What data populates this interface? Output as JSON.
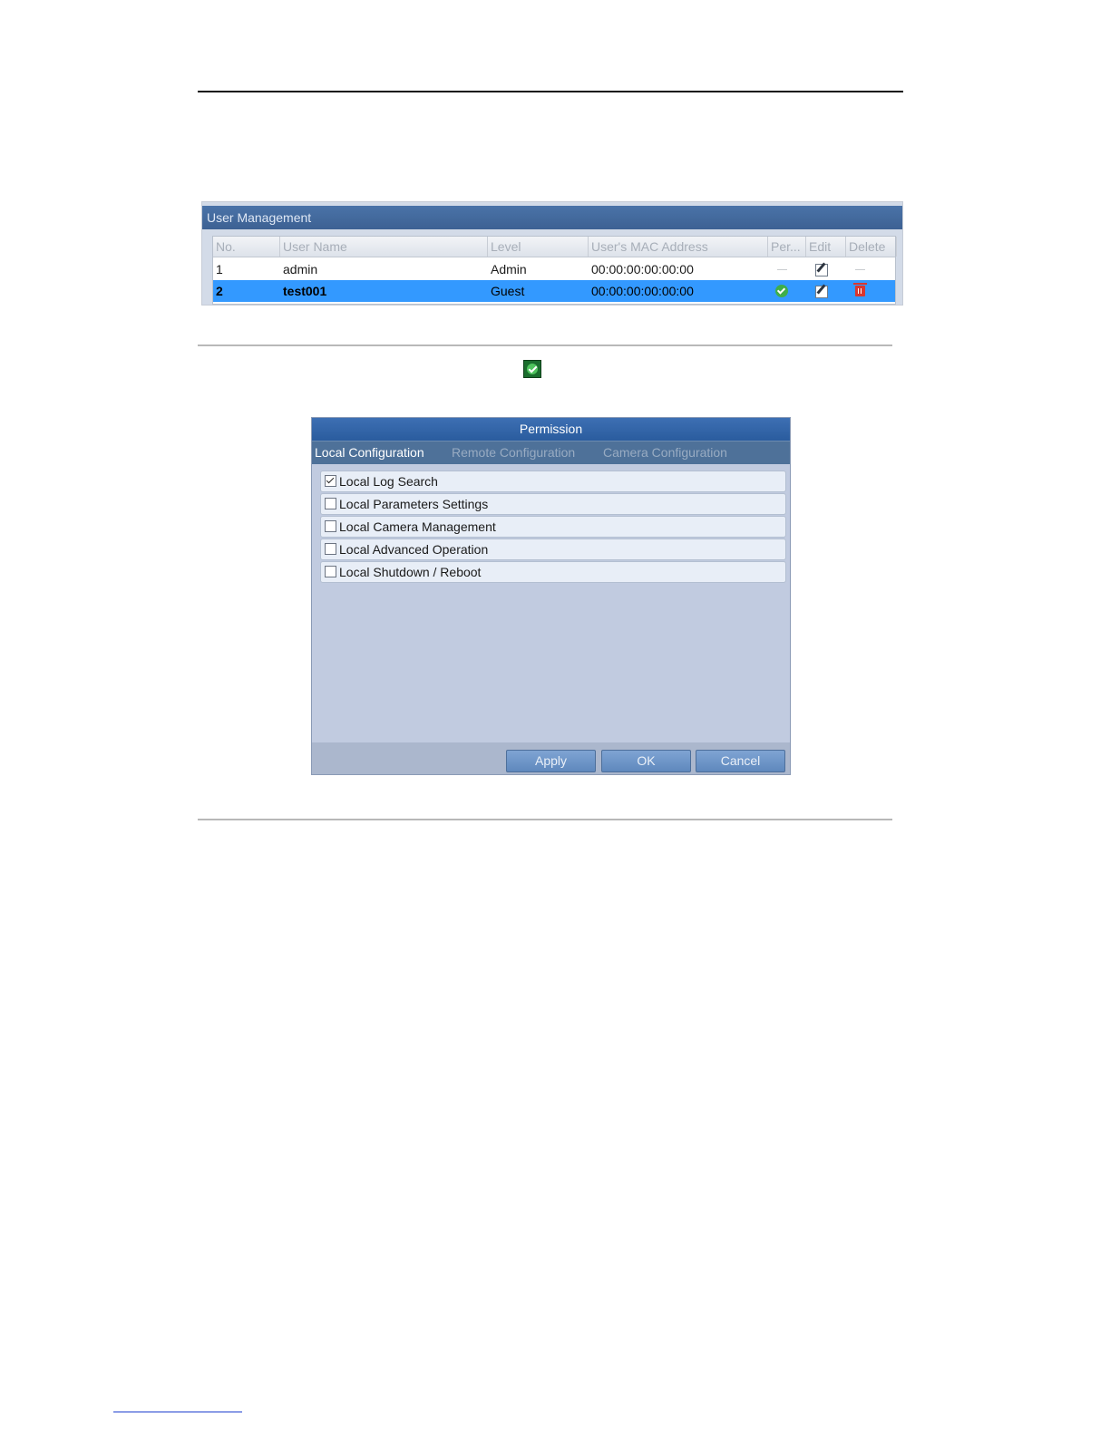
{
  "user_management": {
    "title": "User Management",
    "columns": [
      "No.",
      "User Name",
      "Level",
      "User's MAC Address",
      "Per...",
      "Edit",
      "Delete"
    ],
    "rows": [
      {
        "no": "1",
        "user_name": "admin",
        "level": "Admin",
        "mac": "00:00:00:00:00:00",
        "per": "dash-icon",
        "edit": "edit-icon",
        "delete": "dash-icon",
        "selected": false
      },
      {
        "no": "2",
        "user_name": "test001",
        "level": "Guest",
        "mac": "00:00:00:00:00:00",
        "per": "check-icon",
        "edit": "edit-icon",
        "delete": "trash-icon",
        "selected": true
      }
    ],
    "selected_row_color": "#3399ff"
  },
  "inline_icon": "green-check-icon",
  "permission": {
    "title": "Permission",
    "tabs": [
      {
        "label": "Local Configuration",
        "active": true
      },
      {
        "label": "Remote Configuration",
        "active": false
      },
      {
        "label": "Camera Configuration",
        "active": false
      }
    ],
    "items": [
      {
        "label": "Local Log Search",
        "checked": true
      },
      {
        "label": "Local Parameters Settings",
        "checked": false
      },
      {
        "label": "Local Camera Management",
        "checked": false
      },
      {
        "label": "Local Advanced Operation",
        "checked": false
      },
      {
        "label": "Local Shutdown / Reboot",
        "checked": false
      }
    ],
    "buttons": {
      "apply": "Apply",
      "ok": "OK",
      "cancel": "Cancel"
    }
  }
}
